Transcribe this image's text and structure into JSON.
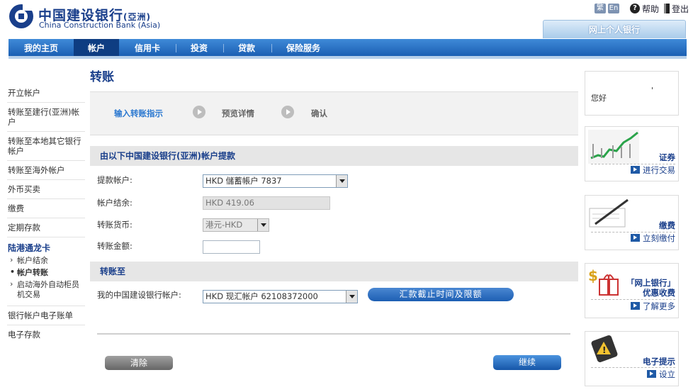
{
  "header": {
    "logo_cn": "中国建设银行",
    "logo_cn_suffix": "(亞洲)",
    "logo_en": "China Construction Bank (Asia)",
    "lang_trad": "繁",
    "lang_en": "En",
    "help": "帮助",
    "logout": "登出",
    "personal_banking_tab": "网上个人银行"
  },
  "nav": {
    "items": [
      "我的主页",
      "帐户",
      "信用卡",
      "投资",
      "贷款",
      "保险服务"
    ],
    "active_index": 1
  },
  "sidebar": {
    "items_top": [
      "开立帐户",
      "转账至建行(亚洲)帐户",
      "转账至本地其它银行帐户",
      "转账至海外帐户",
      "外币买卖",
      "缴费",
      "定期存款"
    ],
    "group_title": "陆港通龙卡",
    "group_items": [
      "帐户结余",
      "帐户转账",
      "启动海外自动柜员机交易"
    ],
    "group_active_index": 1,
    "items_bottom": [
      "银行帐户电子账单",
      "电子存款"
    ]
  },
  "main": {
    "title": "转账",
    "steps": [
      "输入转账指示",
      "预览详情",
      "确认"
    ],
    "current_step": 0,
    "debit_section": "由以下中国建设银行(亚洲)帐户提款",
    "withdraw_label": "提款帐户:",
    "withdraw_value": "HKD 儲蓄帳户  7837",
    "balance_label": "帐户结余:",
    "balance_value": "HKD 419.06",
    "currency_label": "转账货币:",
    "currency_value": "港元-HKD",
    "amount_label": "转账金额:",
    "amount_value": "",
    "credit_section": "转账至",
    "to_account_label": "我的中国建设银行帐户:",
    "to_account_value": "HKD 现汇帐户  62108372000",
    "cutoff_button": "汇款截止时间及限额",
    "clear_button": "清除",
    "continue_button": "继续"
  },
  "right_panel": {
    "greeting": "您好",
    "greeting_mark": "'",
    "boxes": [
      {
        "title": "证券",
        "link": "进行交易"
      },
      {
        "title": "缴费",
        "link": "立刻缴付"
      },
      {
        "title": "「网上银行」优惠收费",
        "link": "了解更多"
      },
      {
        "title": "电子提示",
        "link": "设立"
      }
    ]
  },
  "colors": {
    "brand_blue": "#1a3f8b",
    "nav_blue": "#2f7ad0",
    "nav_active": "#0e3d82",
    "step_current": "#2b78d0"
  }
}
